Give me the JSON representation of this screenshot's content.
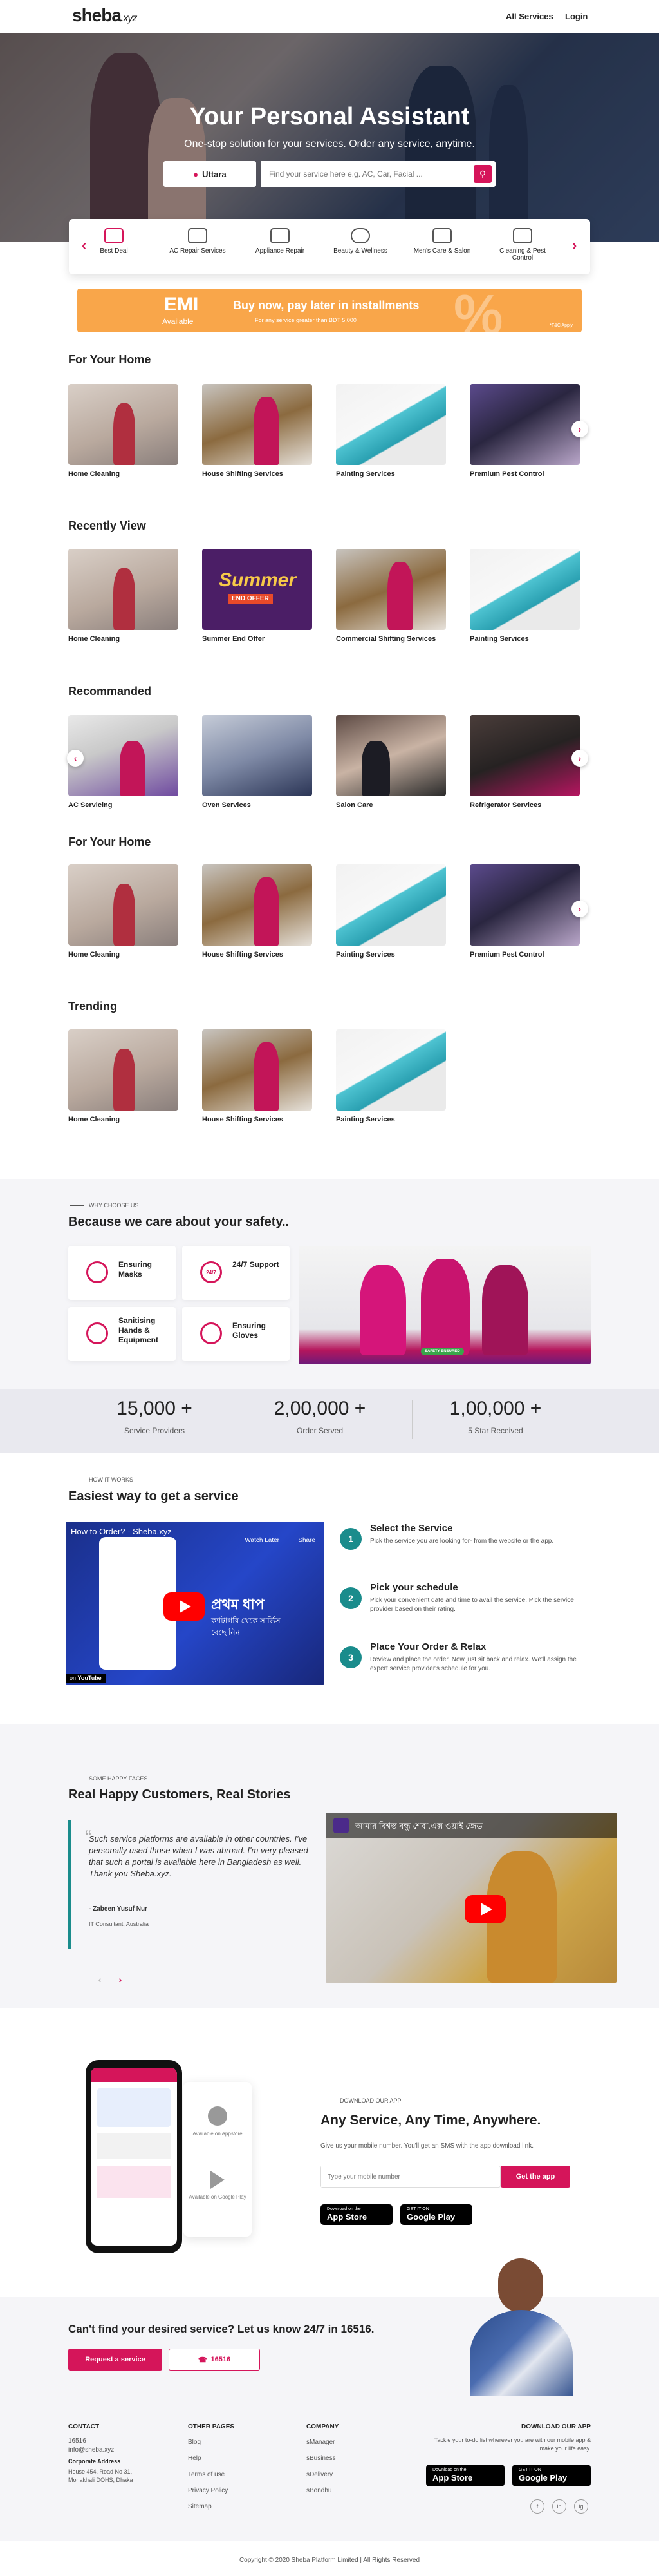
{
  "header": {
    "logo": "sheba",
    "logo_suffix": ".xyz",
    "nav": [
      "All Services",
      "Login"
    ]
  },
  "hero": {
    "title": "Your Personal Assistant",
    "subtitle": "One-stop solution for your services. Order any service, anytime.",
    "location": "Uttara",
    "search_placeholder": "Find your service here e.g. AC, Car, Facial ..."
  },
  "categories": [
    "Best Deal",
    "AC Repair Services",
    "Appliance Repair",
    "Beauty & Wellness",
    "Men's Care & Salon",
    "Cleaning & Pest Control"
  ],
  "emi": {
    "title": "EMI",
    "available": "Available",
    "headline": "Buy now, pay later in installments",
    "note": "For any service greater than BDT 5,000",
    "pct": "%",
    "tc": "*T&C Apply"
  },
  "sections": [
    {
      "title": "For Your Home",
      "items": [
        "Home Cleaning",
        "House Shifting Services",
        "Painting Services",
        "Premium Pest Control"
      ]
    },
    {
      "title": "Recently View",
      "items": [
        "Home Cleaning",
        "Summer End Offer",
        "Commercial Shifting Services",
        "Painting Services"
      ]
    },
    {
      "title": "Recommanded",
      "items": [
        "AC Servicing",
        "Oven Services",
        "Salon Care",
        "Refrigerator Services"
      ]
    },
    {
      "title": "For Your Home",
      "items": [
        "Home Cleaning",
        "House Shifting Services",
        "Painting Services",
        "Premium Pest Control"
      ]
    },
    {
      "title": "Trending",
      "items": [
        "Home Cleaning",
        "House Shifting Services",
        "Painting Services"
      ]
    }
  ],
  "summer_banner": {
    "line1": "Summer",
    "line2": "END OFFER"
  },
  "why": {
    "eyebrow": "WHY CHOOSE US",
    "title": "Because we care about your safety..",
    "cards": [
      "Ensuring Masks",
      "24/7 Support",
      "Sanitising Hands & Equipment",
      "Ensuring Gloves"
    ],
    "badge": "24/7",
    "banner_badge": "SAFETY ENSURED"
  },
  "stats": [
    {
      "value": "15,000 +",
      "label": "Service Providers"
    },
    {
      "value": "2,00,000 +",
      "label": "Order Served"
    },
    {
      "value": "1,00,000 +",
      "label": "5 Star Received"
    }
  ],
  "how": {
    "eyebrow": "HOW IT WORKS",
    "title": "Easiest way to get a service",
    "video_title": "How to Order? - Sheba.xyz",
    "video_watch_later": "Watch Later",
    "video_share": "Share",
    "video_bangla_1": "প্রথম ধাপ",
    "video_bangla_2": "ক্যাটাগরি থেকে সার্ভিস",
    "video_bangla_3": "বেছে নিন",
    "youtube": "YouTube",
    "on": "on",
    "steps": [
      {
        "num": "1",
        "title": "Select the Service",
        "desc": "Pick the service you are looking for- from the website or the app."
      },
      {
        "num": "2",
        "title": "Pick your schedule",
        "desc": "Pick your convenient date and time to avail the service. Pick the service provider based on their rating."
      },
      {
        "num": "3",
        "title": "Place Your Order & Relax",
        "desc": "Review and place the order. Now just sit back and relax. We'll assign the expert service provider's schedule for you."
      }
    ]
  },
  "stories": {
    "eyebrow": "SOME HAPPY FACES",
    "title": "Real Happy Customers, Real Stories",
    "quote": "Such service platforms are available in other countries. I've personally used those when I was abroad. I'm very pleased that such a portal is available here in Bangladesh as well. Thank you Sheba.xyz.",
    "author": "- Zabeen Yusuf Nur",
    "role": "IT Consultant, Australia",
    "video_caption": "আমার বিশ্বস্ত বন্ধু শেবা.এক্স ওয়াই জেড"
  },
  "app": {
    "eyebrow": "DOWNLOAD OUR APP",
    "title": "Any Service, Any Time, Anywhere.",
    "desc": "Give us your mobile number. You'll get an SMS with the app download link.",
    "placeholder": "Type your mobile number",
    "button": "Get the app",
    "appstore_small": "Download on the",
    "appstore": "App Store",
    "gplay_small": "GET IT ON",
    "gplay": "Google Play",
    "card_appstore": "Available on Appstore",
    "card_gplay": "Available on Google Play"
  },
  "cta": {
    "title": "Can't find your desired service? Let us know 24/7 in 16516.",
    "request": "Request a service",
    "phone": "16516"
  },
  "footer": {
    "contact_head": "CONTACT",
    "contact": [
      "16516",
      "info@sheba.xyz"
    ],
    "addr_head": "Corporate Address",
    "addr": [
      "House 454, Road No 31,",
      "Mohakhali DOHS, Dhaka"
    ],
    "other_head": "OTHER PAGES",
    "other": [
      "Blog",
      "Help",
      "Terms of use",
      "Privacy Policy",
      "Sitemap"
    ],
    "company_head": "COMPANY",
    "company": [
      "sManager",
      "sBusiness",
      "sDelivery",
      "sBondhu"
    ],
    "app_head": "DOWNLOAD OUR APP",
    "app_desc": "Tackle your to-do list wherever you are with our mobile app & make your life easy.",
    "social": [
      "f",
      "in",
      "ig"
    ]
  },
  "copyright": "Copyright © 2020 Sheba Platform Limited | All Rights Reserved",
  "colors": {
    "brand": "#d5155a",
    "teal": "#1a8c8c",
    "emi": "#f9a64a"
  }
}
